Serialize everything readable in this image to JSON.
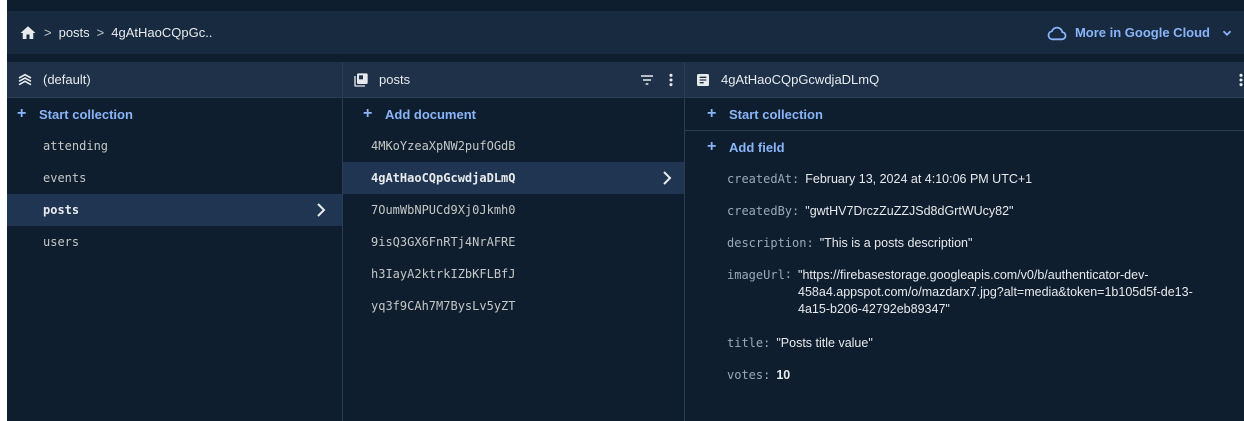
{
  "breadcrumb": {
    "items": [
      "posts",
      "4gAtHaoCQpGc.."
    ]
  },
  "cloud_link": {
    "label": "More in Google Cloud"
  },
  "panel_root": {
    "title": "(default)",
    "action": "Start collection",
    "collections": [
      "attending",
      "events",
      "posts",
      "users"
    ],
    "selected_index": 2
  },
  "panel_collection": {
    "title": "posts",
    "action": "Add document",
    "documents": [
      "4MKoYzeaXpNW2pufOGdB",
      "4gAtHaoCQpGcwdjaDLmQ",
      "7OumWbNPUCd9Xj0Jkmh0",
      "9isQ3GX6FnRTj4NrAFRE",
      "h3IayA2ktrkIZbKFLBfJ",
      "yq3f9CAh7M7BysLv5yZT"
    ],
    "selected_index": 1
  },
  "panel_document": {
    "title": "4gAtHaoCQpGcwdjaDLmQ",
    "action_collection": "Start collection",
    "action_field": "Add field",
    "fields": [
      {
        "key": "createdAt",
        "value": "February 13, 2024 at 4:10:06 PM UTC+1"
      },
      {
        "key": "createdBy",
        "value": "\"gwtHV7DrczZuZZJSd8dGrtWUcy82\""
      },
      {
        "key": "description",
        "value": "\"This is a posts description\""
      },
      {
        "key": "imageUrl",
        "value": "\"https://firebasestorage.googleapis.com/v0/b/authenticator-dev-458a4.appspot.com/o/mazdarx7.jpg?alt=media&token=1b105d5f-de13-4a15-b206-42792eb89347\""
      },
      {
        "key": "title",
        "value": "\"Posts title value\""
      },
      {
        "key": "votes",
        "value": "10"
      }
    ]
  },
  "colors": {
    "background": "#0f1e2f",
    "header": "#1e3148",
    "topbar": "#172a40",
    "accent": "#8ab4f8",
    "selected_row": "#1f3551"
  },
  "icons": [
    "home-icon",
    "chevron-right-icon",
    "cloud-icon",
    "chevron-down-icon",
    "database-icon",
    "collection-icon",
    "filter-icon",
    "more-vert-icon",
    "document-icon"
  ]
}
